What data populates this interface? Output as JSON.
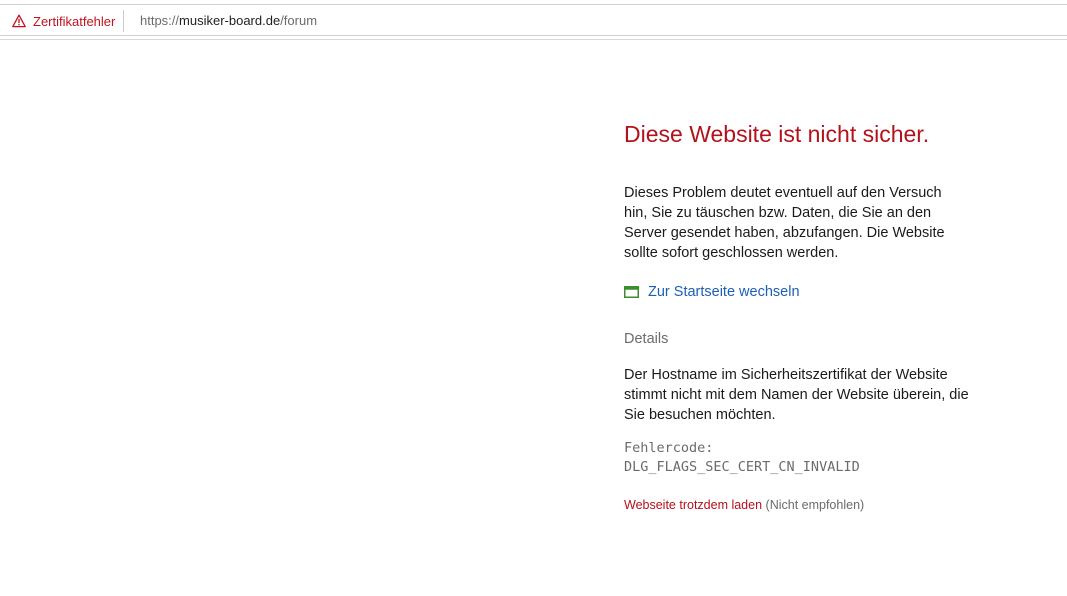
{
  "address_bar": {
    "cert_warning_label": "Zertifikatfehler",
    "cert_warning_icon": "warning-triangle-icon",
    "url_scheme": "https://",
    "url_domain": "musiker-board.de",
    "url_path": "/forum"
  },
  "colors": {
    "error_red": "#b3111b",
    "link_blue": "#1d5fb6",
    "muted_gray": "#6b6b6b"
  },
  "page": {
    "title": "Diese Website ist nicht sicher.",
    "description": "Dieses Problem deutet eventuell auf den Versuch hin, Sie zu täuschen bzw. Daten, die Sie an den Server gesendet haben, abzufangen. Die Website sollte sofort geschlossen werden.",
    "home_link_label": "Zur Startseite wechseln",
    "home_link_icon": "browser-window-icon",
    "details_heading": "Details",
    "details_text": "Der Hostname im Sicherheitszertifikat der Website stimmt nicht mit dem Namen der Website überein, die Sie besuchen möchten.",
    "error_code_label": "Fehlercode:",
    "error_code_value": "DLG_FLAGS_SEC_CERT_CN_INVALID",
    "proceed_link_label": "Webseite trotzdem laden",
    "proceed_note": "(Nicht empfohlen)"
  }
}
